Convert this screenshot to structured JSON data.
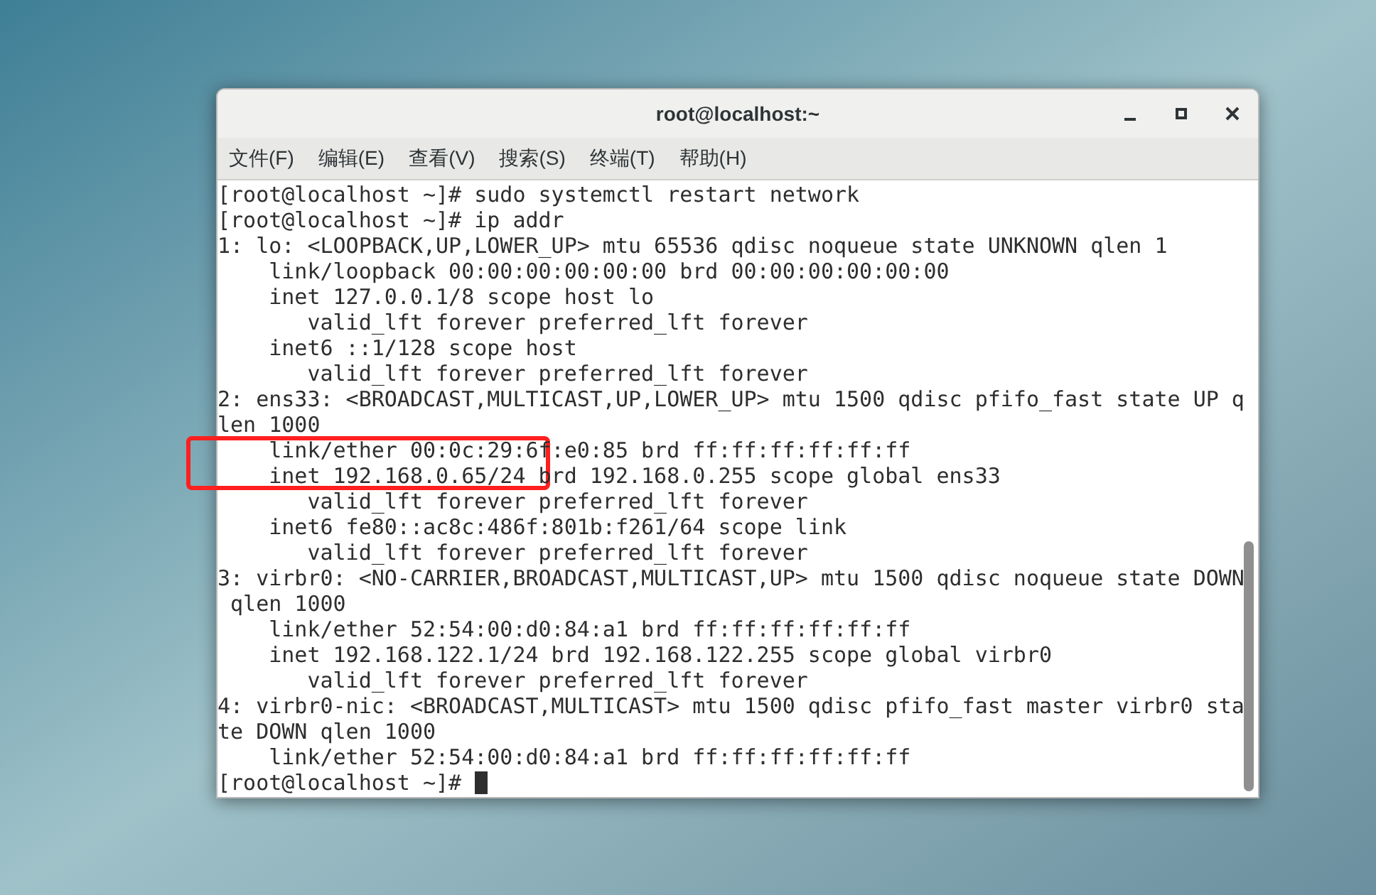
{
  "window": {
    "title": "root@localhost:~"
  },
  "menu": [
    "文件(F)",
    "编辑(E)",
    "查看(V)",
    "搜索(S)",
    "终端(T)",
    "帮助(H)"
  ],
  "terminal": {
    "lines": [
      "[root@localhost ~]# sudo systemctl restart network",
      "[root@localhost ~]# ip addr",
      "1: lo: <LOOPBACK,UP,LOWER_UP> mtu 65536 qdisc noqueue state UNKNOWN qlen 1",
      "    link/loopback 00:00:00:00:00:00 brd 00:00:00:00:00:00",
      "    inet 127.0.0.1/8 scope host lo",
      "       valid_lft forever preferred_lft forever",
      "    inet6 ::1/128 scope host",
      "       valid_lft forever preferred_lft forever",
      "2: ens33: <BROADCAST,MULTICAST,UP,LOWER_UP> mtu 1500 qdisc pfifo_fast state UP q",
      "len 1000",
      "    link/ether 00:0c:29:6f:e0:85 brd ff:ff:ff:ff:ff:ff",
      "    inet 192.168.0.65/24 brd 192.168.0.255 scope global ens33",
      "       valid_lft forever preferred_lft forever",
      "    inet6 fe80::ac8c:486f:801b:f261/64 scope link",
      "       valid_lft forever preferred_lft forever",
      "3: virbr0: <NO-CARRIER,BROADCAST,MULTICAST,UP> mtu 1500 qdisc noqueue state DOWN",
      " qlen 1000",
      "    link/ether 52:54:00:d0:84:a1 brd ff:ff:ff:ff:ff:ff",
      "    inet 192.168.122.1/24 brd 192.168.122.255 scope global virbr0",
      "       valid_lft forever preferred_lft forever",
      "4: virbr0-nic: <BROADCAST,MULTICAST> mtu 1500 qdisc pfifo_fast master virbr0 sta",
      "te DOWN qlen 1000",
      "    link/ether 52:54:00:d0:84:a1 brd ff:ff:ff:ff:ff:ff"
    ],
    "prompt": "[root@localhost ~]#"
  }
}
